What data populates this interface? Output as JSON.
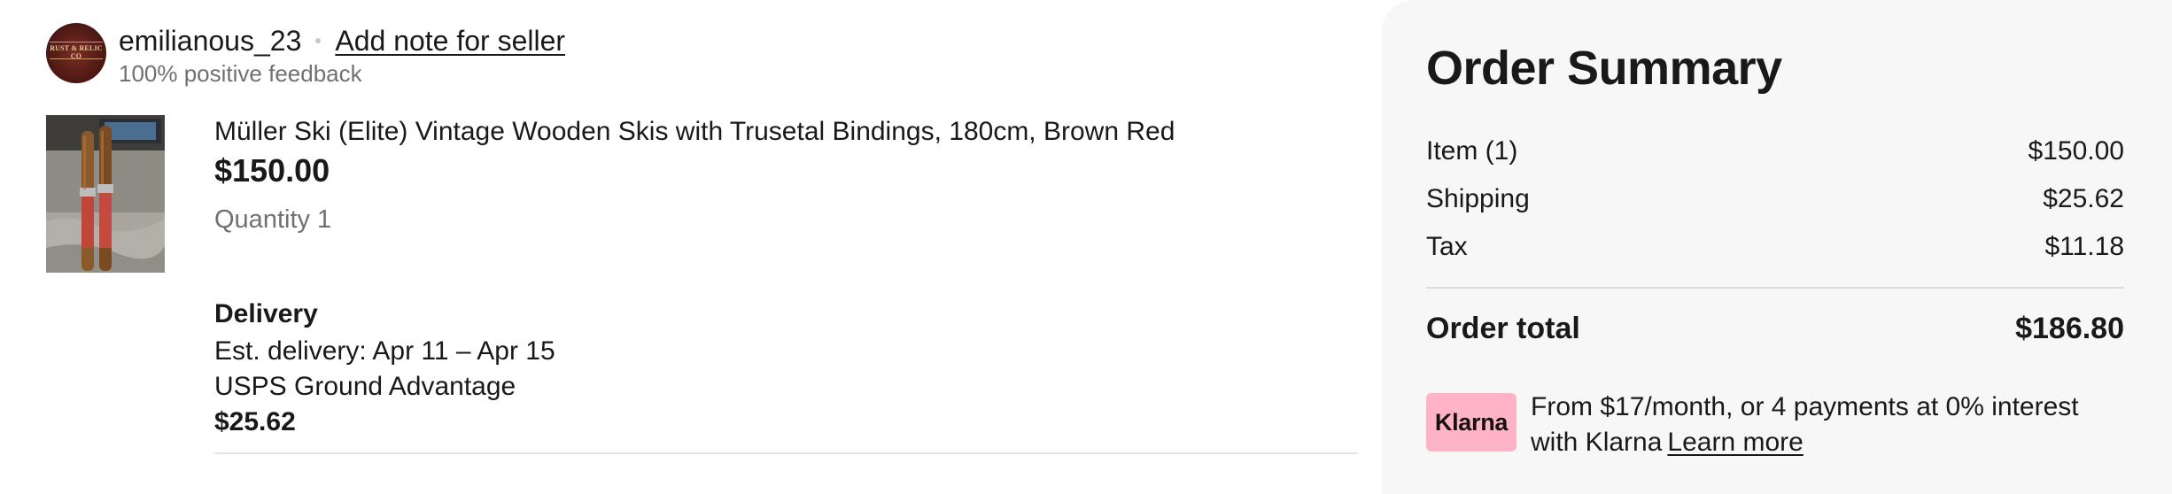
{
  "seller": {
    "name": "emilianous_23",
    "add_note_label": "Add note for seller",
    "feedback": "100% positive feedback",
    "avatar_text": "RUST & RELIC CO"
  },
  "item": {
    "title": "Müller Ski (Elite) Vintage Wooden Skis with Trusetal Bindings, 180cm, Brown Red",
    "price": "$150.00",
    "quantity": "Quantity 1"
  },
  "delivery": {
    "heading": "Delivery",
    "estimate": "Est. delivery: Apr 11 – Apr 15",
    "service": "USPS Ground Advantage",
    "price": "$25.62"
  },
  "summary": {
    "title": "Order Summary",
    "lines": [
      {
        "label": "Item (1)",
        "value": "$150.00"
      },
      {
        "label": "Shipping",
        "value": "$25.62"
      },
      {
        "label": "Tax",
        "value": "$11.18"
      }
    ],
    "total_label": "Order total",
    "total_value": "$186.80",
    "klarna": {
      "badge": "Klarna",
      "text_line1": "From $17/month, or 4 payments at 0% interest",
      "text_line2": "with Klarna",
      "link": "Learn more",
      "badge_color": "#ffb3c7"
    }
  }
}
